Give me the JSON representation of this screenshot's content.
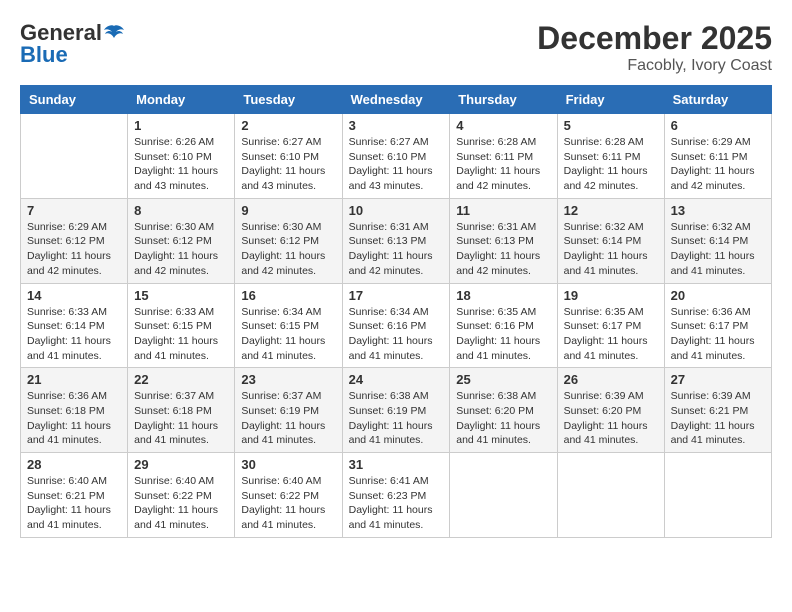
{
  "logo": {
    "line1": "General",
    "line2": "Blue"
  },
  "title": "December 2025",
  "location": "Facobly, Ivory Coast",
  "weekdays": [
    "Sunday",
    "Monday",
    "Tuesday",
    "Wednesday",
    "Thursday",
    "Friday",
    "Saturday"
  ],
  "weeks": [
    [
      {
        "day": "",
        "sunrise": "",
        "sunset": "",
        "daylight": ""
      },
      {
        "day": "1",
        "sunrise": "Sunrise: 6:26 AM",
        "sunset": "Sunset: 6:10 PM",
        "daylight": "Daylight: 11 hours and 43 minutes."
      },
      {
        "day": "2",
        "sunrise": "Sunrise: 6:27 AM",
        "sunset": "Sunset: 6:10 PM",
        "daylight": "Daylight: 11 hours and 43 minutes."
      },
      {
        "day": "3",
        "sunrise": "Sunrise: 6:27 AM",
        "sunset": "Sunset: 6:10 PM",
        "daylight": "Daylight: 11 hours and 43 minutes."
      },
      {
        "day": "4",
        "sunrise": "Sunrise: 6:28 AM",
        "sunset": "Sunset: 6:11 PM",
        "daylight": "Daylight: 11 hours and 42 minutes."
      },
      {
        "day": "5",
        "sunrise": "Sunrise: 6:28 AM",
        "sunset": "Sunset: 6:11 PM",
        "daylight": "Daylight: 11 hours and 42 minutes."
      },
      {
        "day": "6",
        "sunrise": "Sunrise: 6:29 AM",
        "sunset": "Sunset: 6:11 PM",
        "daylight": "Daylight: 11 hours and 42 minutes."
      }
    ],
    [
      {
        "day": "7",
        "sunrise": "Sunrise: 6:29 AM",
        "sunset": "Sunset: 6:12 PM",
        "daylight": "Daylight: 11 hours and 42 minutes."
      },
      {
        "day": "8",
        "sunrise": "Sunrise: 6:30 AM",
        "sunset": "Sunset: 6:12 PM",
        "daylight": "Daylight: 11 hours and 42 minutes."
      },
      {
        "day": "9",
        "sunrise": "Sunrise: 6:30 AM",
        "sunset": "Sunset: 6:12 PM",
        "daylight": "Daylight: 11 hours and 42 minutes."
      },
      {
        "day": "10",
        "sunrise": "Sunrise: 6:31 AM",
        "sunset": "Sunset: 6:13 PM",
        "daylight": "Daylight: 11 hours and 42 minutes."
      },
      {
        "day": "11",
        "sunrise": "Sunrise: 6:31 AM",
        "sunset": "Sunset: 6:13 PM",
        "daylight": "Daylight: 11 hours and 42 minutes."
      },
      {
        "day": "12",
        "sunrise": "Sunrise: 6:32 AM",
        "sunset": "Sunset: 6:14 PM",
        "daylight": "Daylight: 11 hours and 41 minutes."
      },
      {
        "day": "13",
        "sunrise": "Sunrise: 6:32 AM",
        "sunset": "Sunset: 6:14 PM",
        "daylight": "Daylight: 11 hours and 41 minutes."
      }
    ],
    [
      {
        "day": "14",
        "sunrise": "Sunrise: 6:33 AM",
        "sunset": "Sunset: 6:14 PM",
        "daylight": "Daylight: 11 hours and 41 minutes."
      },
      {
        "day": "15",
        "sunrise": "Sunrise: 6:33 AM",
        "sunset": "Sunset: 6:15 PM",
        "daylight": "Daylight: 11 hours and 41 minutes."
      },
      {
        "day": "16",
        "sunrise": "Sunrise: 6:34 AM",
        "sunset": "Sunset: 6:15 PM",
        "daylight": "Daylight: 11 hours and 41 minutes."
      },
      {
        "day": "17",
        "sunrise": "Sunrise: 6:34 AM",
        "sunset": "Sunset: 6:16 PM",
        "daylight": "Daylight: 11 hours and 41 minutes."
      },
      {
        "day": "18",
        "sunrise": "Sunrise: 6:35 AM",
        "sunset": "Sunset: 6:16 PM",
        "daylight": "Daylight: 11 hours and 41 minutes."
      },
      {
        "day": "19",
        "sunrise": "Sunrise: 6:35 AM",
        "sunset": "Sunset: 6:17 PM",
        "daylight": "Daylight: 11 hours and 41 minutes."
      },
      {
        "day": "20",
        "sunrise": "Sunrise: 6:36 AM",
        "sunset": "Sunset: 6:17 PM",
        "daylight": "Daylight: 11 hours and 41 minutes."
      }
    ],
    [
      {
        "day": "21",
        "sunrise": "Sunrise: 6:36 AM",
        "sunset": "Sunset: 6:18 PM",
        "daylight": "Daylight: 11 hours and 41 minutes."
      },
      {
        "day": "22",
        "sunrise": "Sunrise: 6:37 AM",
        "sunset": "Sunset: 6:18 PM",
        "daylight": "Daylight: 11 hours and 41 minutes."
      },
      {
        "day": "23",
        "sunrise": "Sunrise: 6:37 AM",
        "sunset": "Sunset: 6:19 PM",
        "daylight": "Daylight: 11 hours and 41 minutes."
      },
      {
        "day": "24",
        "sunrise": "Sunrise: 6:38 AM",
        "sunset": "Sunset: 6:19 PM",
        "daylight": "Daylight: 11 hours and 41 minutes."
      },
      {
        "day": "25",
        "sunrise": "Sunrise: 6:38 AM",
        "sunset": "Sunset: 6:20 PM",
        "daylight": "Daylight: 11 hours and 41 minutes."
      },
      {
        "day": "26",
        "sunrise": "Sunrise: 6:39 AM",
        "sunset": "Sunset: 6:20 PM",
        "daylight": "Daylight: 11 hours and 41 minutes."
      },
      {
        "day": "27",
        "sunrise": "Sunrise: 6:39 AM",
        "sunset": "Sunset: 6:21 PM",
        "daylight": "Daylight: 11 hours and 41 minutes."
      }
    ],
    [
      {
        "day": "28",
        "sunrise": "Sunrise: 6:40 AM",
        "sunset": "Sunset: 6:21 PM",
        "daylight": "Daylight: 11 hours and 41 minutes."
      },
      {
        "day": "29",
        "sunrise": "Sunrise: 6:40 AM",
        "sunset": "Sunset: 6:22 PM",
        "daylight": "Daylight: 11 hours and 41 minutes."
      },
      {
        "day": "30",
        "sunrise": "Sunrise: 6:40 AM",
        "sunset": "Sunset: 6:22 PM",
        "daylight": "Daylight: 11 hours and 41 minutes."
      },
      {
        "day": "31",
        "sunrise": "Sunrise: 6:41 AM",
        "sunset": "Sunset: 6:23 PM",
        "daylight": "Daylight: 11 hours and 41 minutes."
      },
      {
        "day": "",
        "sunrise": "",
        "sunset": "",
        "daylight": ""
      },
      {
        "day": "",
        "sunrise": "",
        "sunset": "",
        "daylight": ""
      },
      {
        "day": "",
        "sunrise": "",
        "sunset": "",
        "daylight": ""
      }
    ]
  ]
}
